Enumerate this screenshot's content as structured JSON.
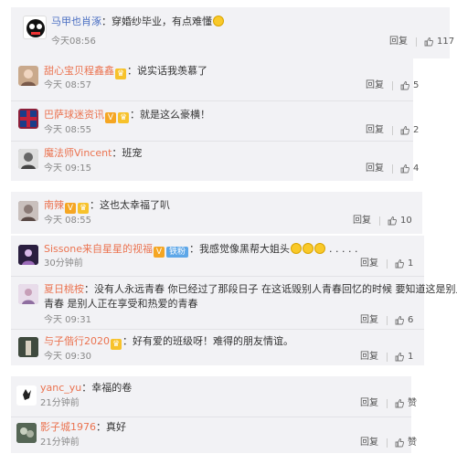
{
  "comments": [
    {
      "name": "马甲也肖涿",
      "text": "穿婚纱毕业，有点难懂",
      "time": "今天08:56",
      "reply": "回复",
      "likes": "117",
      "avatar_color": "#222222"
    },
    {
      "name": "甜心宝贝程鑫鑫",
      "text": "说实话我羡慕了",
      "time": "今天 08:57",
      "reply": "回复",
      "likes": "5",
      "avatar_color": "#c9a98c"
    },
    {
      "name": "巴萨球迷资讯",
      "text": "就是这么豪横！",
      "time": "今天 08:55",
      "reply": "回复",
      "likes": "2",
      "avatar_color": "#8b1f3a"
    },
    {
      "name": "魔法师Vincent",
      "text": "班宠",
      "time": "今天 09:15",
      "reply": "回复",
      "likes": "4",
      "avatar_color": "#888888"
    },
    {
      "name": "南辣",
      "text": "这也太幸福了叭",
      "time": "今天 08:55",
      "reply": "回复",
      "likes": "10",
      "avatar_color": "#7a6a66"
    },
    {
      "name": "Sissone来自星星的视福",
      "tag": "铁粉",
      "text": "我感觉像黑帮大姐头",
      "dots": ". . . . .",
      "time": "30分钟前",
      "reply": "回复",
      "likes": "1",
      "avatar_color": "#5b4a7a"
    },
    {
      "name": "夏日桃桉",
      "text_line1": "没有人永远青春 你已经过了那段日子 在这诋毁别人青春回忆的时候 要知道这是别人的",
      "text_line2": "青春 是别人正在享受和热爱的青春",
      "time": "今天 09:31",
      "reply": "回复",
      "likes": "6",
      "avatar_color": "#b8a8c8"
    },
    {
      "name": "与子偕行2020",
      "text": "好有爱的班级呀！难得的朋友情谊。",
      "time": "今天 09:30",
      "reply": "回复",
      "likes": "1",
      "avatar_color": "#2f3a30"
    },
    {
      "name": "yanc_yu",
      "text": "幸福的卷",
      "time": "21分钟前",
      "reply": "回复",
      "likes": "赞",
      "avatar_color": "#ffffff"
    },
    {
      "name": "影子城1976",
      "text": "真好",
      "time": "21分钟前",
      "reply": "回复",
      "likes": "赞",
      "avatar_color": "#3a4a3a"
    }
  ],
  "colors": {
    "name": "#eb7350",
    "background": "#f2f2f5"
  },
  "icons": {
    "like": "thumbs-up-icon",
    "vip": "v-badge-icon",
    "crown": "crown-badge-icon",
    "emoji": "laughing-emoji-icon"
  },
  "badges": {
    "v": "V",
    "crown": "♛"
  }
}
